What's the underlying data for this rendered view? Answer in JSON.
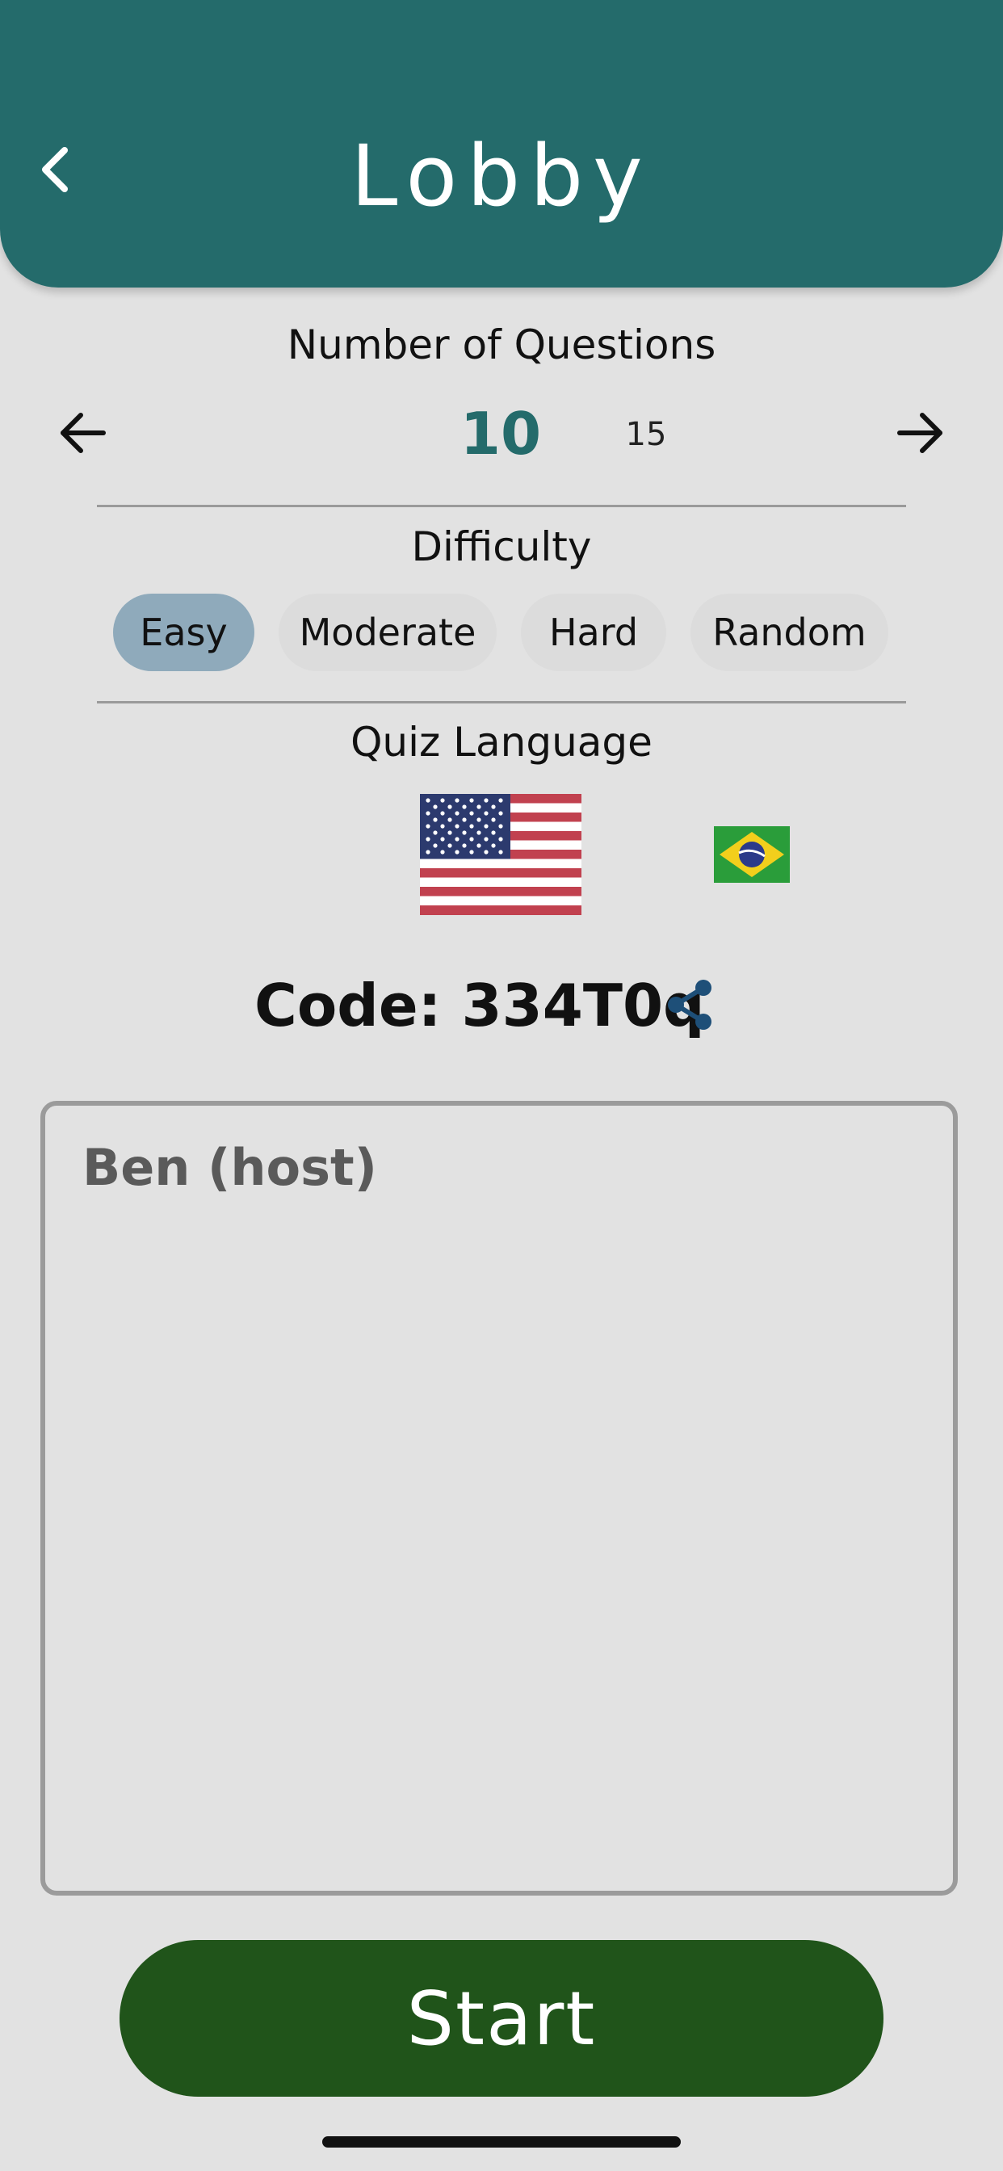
{
  "header": {
    "title": "Lobby",
    "back_icon": "chevron-left-icon",
    "color": "#246b6b"
  },
  "questions": {
    "label": "Number of Questions",
    "current": "10",
    "next": "15",
    "prev_icon": "arrow-left-icon",
    "next_icon": "arrow-right-icon"
  },
  "difficulty": {
    "label": "Difficulty",
    "options": [
      "Easy",
      "Moderate",
      "Hard",
      "Random"
    ],
    "selected": "Easy"
  },
  "language": {
    "label": "Quiz Language",
    "options": [
      "us-flag",
      "brazil-flag"
    ],
    "selected": "us-flag"
  },
  "code": {
    "text": "Code: 334T0q",
    "share_icon": "share-icon"
  },
  "players": [
    {
      "name": "Ben (host)"
    }
  ],
  "start_button": {
    "label": "Start",
    "color": "#20541a"
  }
}
